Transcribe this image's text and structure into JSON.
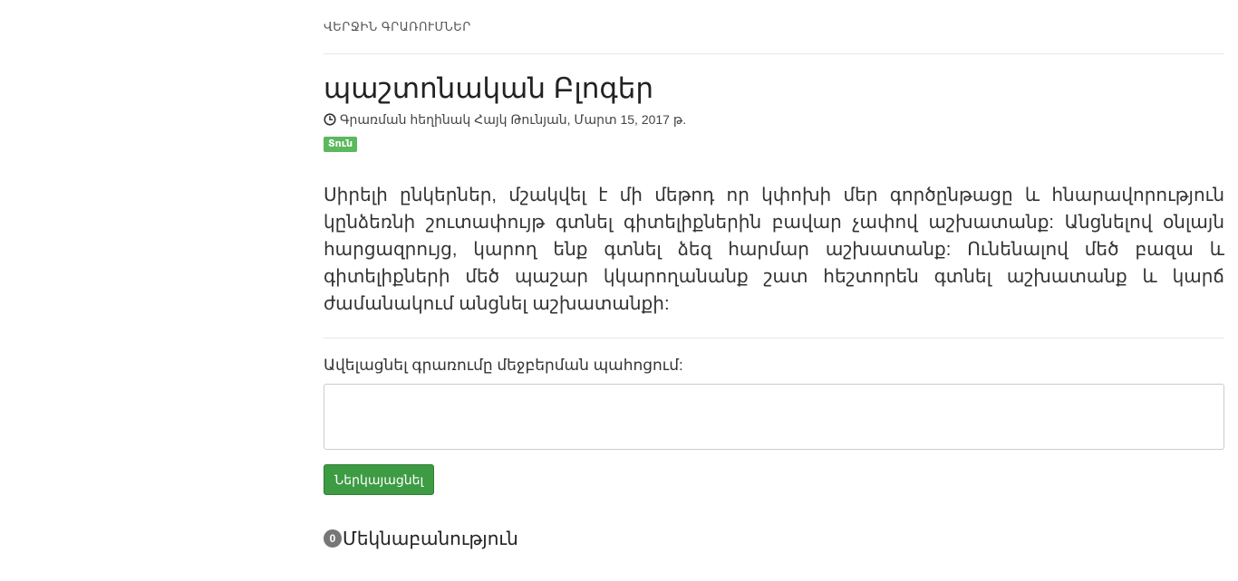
{
  "section": {
    "header": "ՎԵՐՋԻՆ ԳՐԱՌՈՒՄՆԵՐ"
  },
  "post": {
    "title": "պաշտոնական Բլոգեր",
    "meta": "Գրառման հեղինակ Հայկ Թունյան, Մարտ 15, 2017 թ.",
    "tag": "Տուն",
    "body": "Սիրելի ընկերներ, մշակվել է մի մեթոդ որ կփոխի մեր գործընթացը և հնարավորություն կընձեռնի շուտափույթ գտնել գիտելիքներին բավար չափով աշխատանք: Անցնելով օնլայն հարցազրույց, կարող ենք գտնել ձեզ հարմար աշխատանք: Ունենալով մեծ բազա և գիտելիքների մեծ պաշար կկարողանանք շատ հեշտորեն գտնել աշխատանք և կարճ ժամանակում անցնել աշխատանքի:"
  },
  "comment_form": {
    "label": "Ավելացնել գրառումը մեջբերման պահոցում:",
    "value": "",
    "submit_label": "Ներկայացնել"
  },
  "comments": {
    "count": "0",
    "heading": "Մեկնաբանություն"
  },
  "colors": {
    "tag_bg": "#5cb85c",
    "button_bg": "#3d9b44",
    "badge_bg": "#777777"
  },
  "icons": {
    "meta": "clock-icon"
  }
}
